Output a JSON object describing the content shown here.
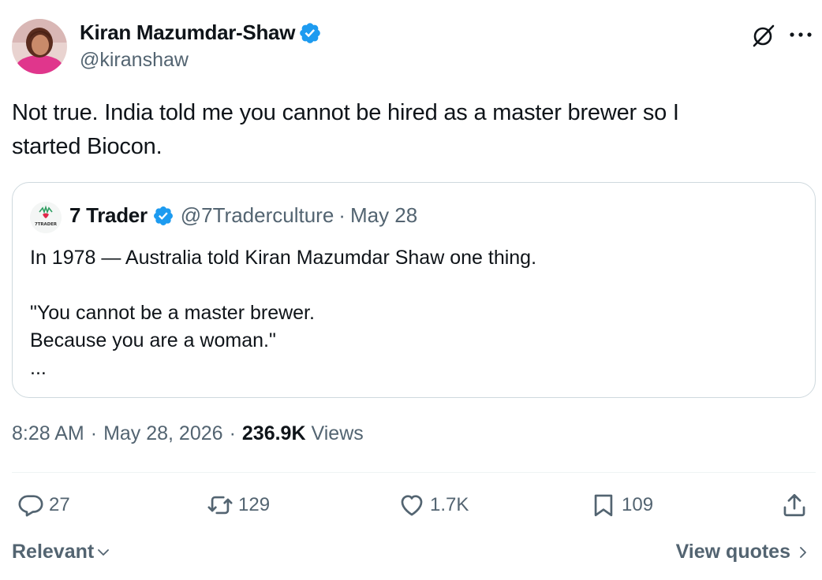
{
  "author": {
    "display_name": "Kiran Mazumdar-Shaw",
    "handle": "@kiranshaw",
    "verified": true
  },
  "tweet": {
    "lines": [
      "Not true. India told me you cannot be hired as a master brewer so I",
      "started Biocon."
    ]
  },
  "quoted_tweet": {
    "display_name": "7 Trader",
    "handle": "@7Traderculture",
    "separator": "·",
    "date": "May 28",
    "avatar_label": "7TRADER",
    "body_lines": [
      "In 1978 — Australia told Kiran Mazumdar Shaw one thing.",
      "",
      "\"You cannot be a master brewer.",
      "Because you are a woman.\"",
      "..."
    ]
  },
  "meta": {
    "time": "8:28 AM",
    "separator": "·",
    "date": "May 28, 2026",
    "views_count": "236.9K",
    "views_label": "Views"
  },
  "actions": {
    "replies": "27",
    "reposts": "129",
    "likes": "1.7K",
    "bookmarks": "109"
  },
  "footer": {
    "sort_label": "Relevant",
    "view_quotes_label": "View quotes"
  },
  "icons": {
    "verified": "verified-badge-icon",
    "grok": "grok-icon",
    "more": "more-dots-icon",
    "reply": "reply-icon",
    "repost": "repost-icon",
    "like": "heart-icon",
    "bookmark": "bookmark-icon",
    "share": "share-icon"
  },
  "colors": {
    "verified_blue": "#1d9bf0",
    "text_primary": "#0f1419",
    "text_secondary": "#536471",
    "border": "#cfd9de"
  }
}
